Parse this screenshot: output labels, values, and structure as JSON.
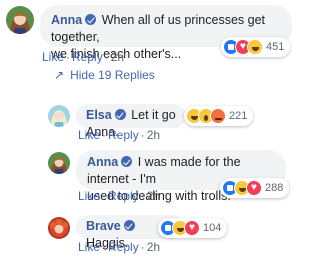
{
  "comment": {
    "author": "Anna",
    "text_line1": "When all of us princesses get together,",
    "text_line2": "we finish each other's...",
    "actions": {
      "like": "Like",
      "reply": "Reply",
      "time": "2h"
    },
    "reactions": {
      "count": "451",
      "icons": [
        "like",
        "love",
        "haha"
      ]
    }
  },
  "hide_replies": {
    "arrow": "↗",
    "label": "Hide 19 Replies"
  },
  "replies": [
    {
      "author": "Elsa",
      "text": "Let it go Anna.",
      "actions": {
        "like": "Like",
        "reply": "Reply",
        "time": "2h"
      },
      "reactions": {
        "count": "221",
        "icons": [
          "haha",
          "wow",
          "angry"
        ]
      }
    },
    {
      "author": "Anna",
      "text_line1": "I was made for the internet - I'm",
      "text_line2": "used to dealing with trolls.",
      "actions": {
        "like": "Like",
        "reply": "Reply",
        "time": "2h"
      },
      "reactions": {
        "count": "288",
        "icons": [
          "like",
          "haha",
          "love"
        ]
      }
    },
    {
      "author": "Brave",
      "text": "Haggis.",
      "actions": {
        "like": "Like",
        "reply": "Reply",
        "time": "2h"
      },
      "reactions": {
        "count": "104",
        "icons": [
          "like",
          "haha",
          "love"
        ]
      }
    }
  ],
  "colors": {
    "author": "#385898",
    "link": "#4267b2",
    "bubble": "#f2f3f5",
    "meta": "#606770"
  }
}
